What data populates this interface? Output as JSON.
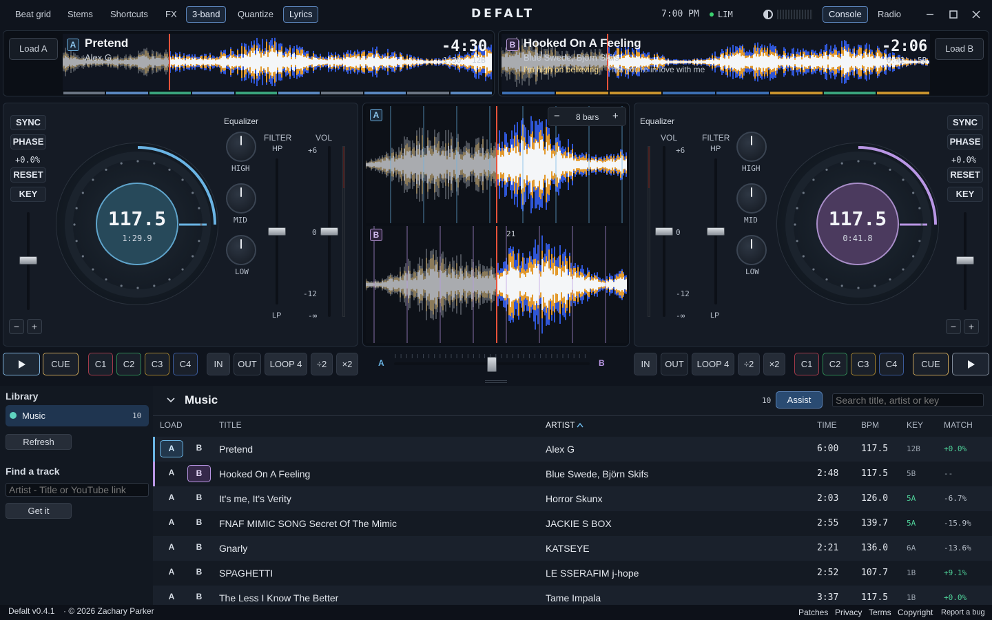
{
  "topbar": {
    "menu": [
      "Beat grid",
      "Stems",
      "Shortcuts",
      "FX",
      "3-band",
      "Quantize",
      "Lyrics"
    ],
    "brand": "DEFALT",
    "clock": "7:00 PM",
    "lim": "LIM",
    "console": "Console",
    "radio": "Radio"
  },
  "deckA": {
    "load": "Load A",
    "badge": "A",
    "title": "Pretend",
    "artist": "Alex G",
    "remaining": "-4:30",
    "elapsed": "1:30",
    "key": "12B",
    "bpm": "117.5",
    "pos": "1:29.9",
    "pitch": "+0.0%"
  },
  "deckB": {
    "load": "Load B",
    "badge": "B",
    "title": "Hooked On A Feeling",
    "artist": "Blue Swede, Björn Skifs",
    "remaining": "-2:06",
    "elapsed": "0:42",
    "key": "5B",
    "lyric1": "I'm high on believing",
    "lyric2": "That you're in love with me",
    "bpm": "117.5",
    "pos": "0:41.8",
    "pitch": "+0.0%"
  },
  "deckbtns": {
    "sync": "SYNC",
    "phase": "PHASE",
    "reset": "RESET",
    "key": "KEY",
    "minus": "−",
    "plus": "+"
  },
  "mixer": {
    "equalizer": "Equalizer",
    "filter": "FILTER",
    "hp": "HP",
    "lp": "LP",
    "vol": "VOL",
    "high": "HIGH",
    "mid": "MID",
    "low": "LOW",
    "db_p6": "+6",
    "db_0": "0",
    "db_m12": "-12",
    "db_inf": "-∞"
  },
  "center": {
    "bars": "8 bars",
    "minus": "−",
    "plus": "+",
    "beat": "21",
    "badgeA": "A",
    "badgeB": "B"
  },
  "controls": {
    "cue": "CUE",
    "c1": "C1",
    "c2": "C2",
    "c3": "C3",
    "c4": "C4",
    "in": "IN",
    "out": "OUT",
    "loop": "LOOP 4",
    "half": "÷2",
    "double": "×2",
    "xa": "A",
    "xb": "B"
  },
  "library": {
    "heading": "Library",
    "item": "Music",
    "count": "10",
    "refresh": "Refresh",
    "find": "Find a track",
    "find_placeholder": "Artist - Title or YouTube link",
    "getit": "Get it"
  },
  "main": {
    "title": "Music",
    "count": "10",
    "assist": "Assist",
    "search_placeholder": "Search title, artist or key",
    "headers": {
      "load": "LOAD",
      "title": "TITLE",
      "artist": "ARTIST",
      "time": "TIME",
      "bpm": "BPM",
      "key": "KEY",
      "match": "MATCH"
    },
    "rows": [
      {
        "a": "A",
        "b": "B",
        "title": "Pretend",
        "artist": "Alex G",
        "time": "6:00",
        "bpm": "117.5",
        "key": "12B",
        "match": "+0.0%"
      },
      {
        "a": "A",
        "b": "B",
        "title": "Hooked On A Feeling",
        "artist": "Blue Swede, Björn Skifs",
        "time": "2:48",
        "bpm": "117.5",
        "key": "5B",
        "match": "--"
      },
      {
        "a": "A",
        "b": "B",
        "title": "It's me, It's Verity",
        "artist": "Horror Skunx",
        "time": "2:03",
        "bpm": "126.0",
        "key": "5A",
        "match": "-6.7%"
      },
      {
        "a": "A",
        "b": "B",
        "title": "FNAF MIMIC SONG Secret Of The Mimic",
        "artist": "JACKIE S BOX",
        "time": "2:55",
        "bpm": "139.7",
        "key": "5A",
        "match": "-15.9%"
      },
      {
        "a": "A",
        "b": "B",
        "title": "Gnarly",
        "artist": "KATSEYE",
        "time": "2:21",
        "bpm": "136.0",
        "key": "6A",
        "match": "-13.6%"
      },
      {
        "a": "A",
        "b": "B",
        "title": "SPAGHETTI",
        "artist": "LE SSERAFIM j-hope",
        "time": "2:52",
        "bpm": "107.7",
        "key": "1B",
        "match": "+9.1%"
      },
      {
        "a": "A",
        "b": "B",
        "title": "The Less I Know The Better",
        "artist": "Tame Impala",
        "time": "3:37",
        "bpm": "117.5",
        "key": "1B",
        "match": "+0.0%"
      }
    ]
  },
  "footer": {
    "version": "Defalt v0.4.1",
    "copyright": "· © 2026 Zachary Parker",
    "patches": "Patches",
    "privacy": "Privacy",
    "terms": "Terms",
    "copyright_link": "Copyright",
    "bug": "Report a bug"
  },
  "colors": {
    "deckA": "#6ab4e4",
    "deckB": "#b996e4",
    "wave_orange": "#e39a2e",
    "wave_blue": "#2f56d6",
    "playhead": "#e8523a"
  }
}
